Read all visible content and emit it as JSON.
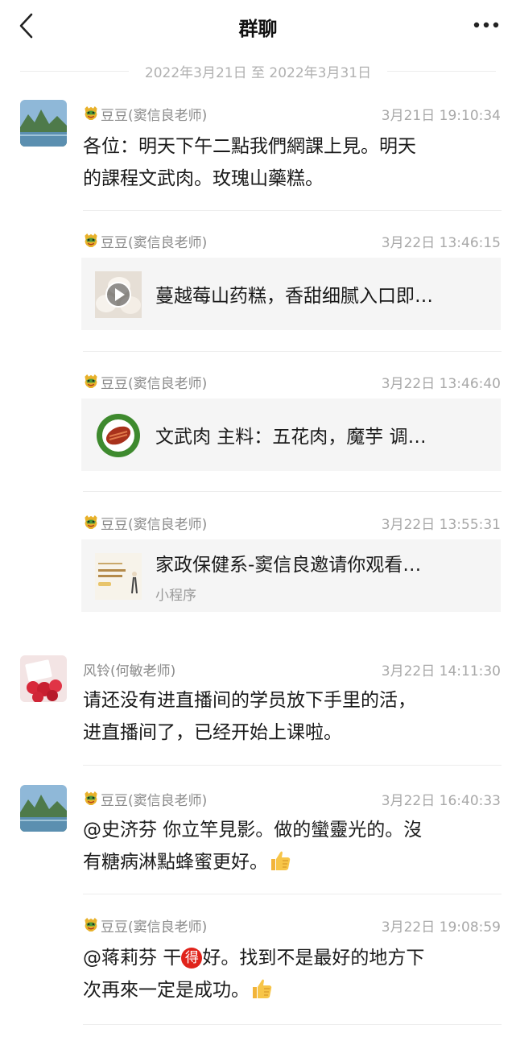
{
  "header": {
    "title": "群聊"
  },
  "date_range": "2022年3月21日 至 2022年3月31日",
  "messages": [
    {
      "sender": "豆豆(窦信良老师)",
      "time": "3月21日 19:10:34",
      "text_lines": [
        "各位：明天下午二點我們網課上見。明天",
        "的課程文武肉。玫瑰山藥糕。"
      ]
    },
    {
      "sender": "豆豆(窦信良老师)",
      "time": "3月22日 13:46:15",
      "card_title": "蔓越莓山药糕，香甜细腻入口即…"
    },
    {
      "sender": "豆豆(窦信良老师)",
      "time": "3月22日 13:46:40",
      "card_title": "文武肉 主料：五花肉，魔芋 调…"
    },
    {
      "sender": "豆豆(窦信良老师)",
      "time": "3月22日 13:55:31",
      "card_title": "家政保健系-窦信良邀请你观看…",
      "card_subtitle": "小程序"
    },
    {
      "sender": "风铃(何敏老师)",
      "time": "3月22日 14:11:30",
      "text_lines": [
        "请还没有进直播间的学员放下手里的活，",
        "进直播间了，已经开始上课啦。"
      ]
    },
    {
      "sender": "豆豆(窦信良老师)",
      "time": "3月22日 16:40:33",
      "text_line1": "@史济芬 你立竿見影。做的蠻靈光的。沒",
      "text_line2": "有糖病淋點蜂蜜更好。"
    },
    {
      "sender": "豆豆(窦信良老师)",
      "time": "3月22日 19:08:59",
      "text_line1_pre": "@蒋莉芬 干",
      "text_line1_badge": "得",
      "text_line1_post": "好。找到不是最好的地方下",
      "text_line2": "次再來一定是成功。"
    }
  ],
  "icons": {
    "back": "chevron-left-icon",
    "more": "more-dots-icon",
    "user_badge": "dragon-face-icon",
    "play": "play-icon",
    "thumbs_up": "thumbs-up-emoji"
  },
  "colors": {
    "time_gray": "#a8a8a8",
    "name_gray": "#8a8a8a",
    "card_bg": "#f5f5f5",
    "badge_red": "#e0231b"
  }
}
